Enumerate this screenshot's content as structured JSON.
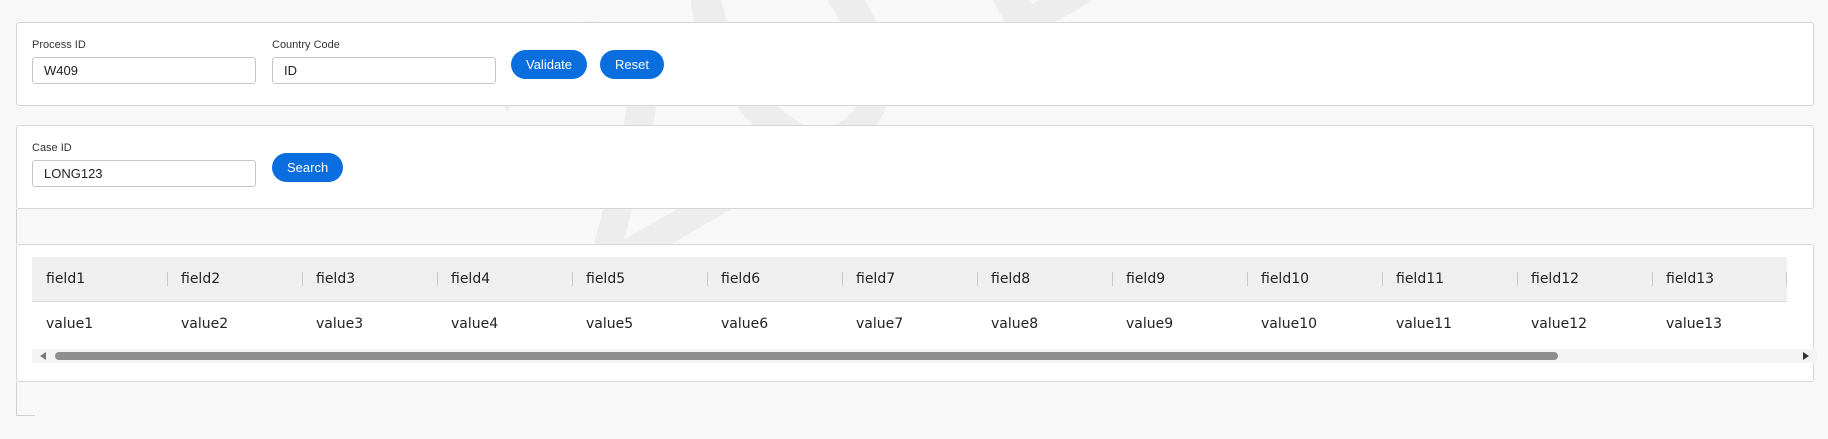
{
  "watermark": "2013176",
  "process_form": {
    "process_id_label": "Process ID",
    "process_id_value": "W409",
    "country_code_label": "Country Code",
    "country_code_value": "ID",
    "validate_label": "Validate",
    "reset_label": "Reset"
  },
  "case_form": {
    "case_id_label": "Case ID",
    "case_id_value": "LONG123",
    "search_label": "Search"
  },
  "table": {
    "columns": [
      "field1",
      "field2",
      "field3",
      "field4",
      "field5",
      "field6",
      "field7",
      "field8",
      "field9",
      "field10",
      "field11",
      "field12",
      "field13"
    ],
    "rows": [
      [
        "value1",
        "value2",
        "value3",
        "value4",
        "value5",
        "value6",
        "value7",
        "value8",
        "value9",
        "value10",
        "value11",
        "value12",
        "value13"
      ]
    ]
  },
  "colors": {
    "accent": "#0a6ede",
    "background": "#f8f8f8"
  }
}
